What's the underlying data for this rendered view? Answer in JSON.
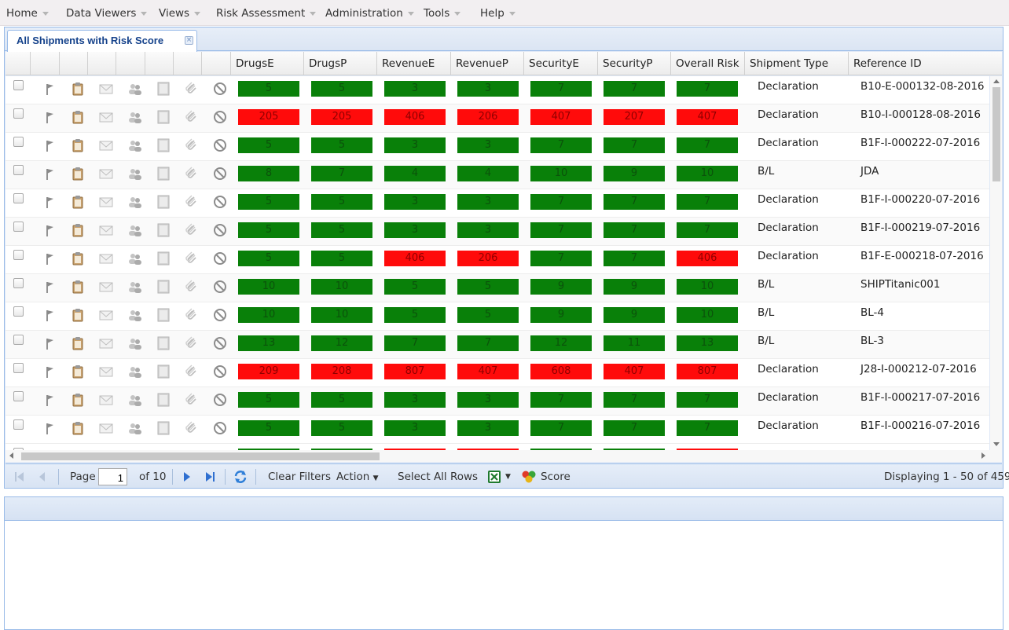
{
  "menu": [
    {
      "label": "Home"
    },
    {
      "label": "Data Viewers"
    },
    {
      "label": "Views"
    },
    {
      "label": "Risk Assessment"
    },
    {
      "label": "Administration"
    },
    {
      "label": "Tools"
    },
    {
      "label": "Help"
    }
  ],
  "tab": {
    "title": "All Shipments with Risk Score"
  },
  "columns": [
    "DrugsE",
    "DrugsP",
    "RevenueE",
    "RevenueP",
    "SecurityE",
    "SecurityP",
    "Overall Risk",
    "Shipment Type",
    "Reference ID"
  ],
  "row_icons": [
    "flag-icon",
    "clipboard-icon",
    "envelope-icon",
    "people-icon",
    "document-icon",
    "paperclip-icon",
    "block-icon"
  ],
  "colors": {
    "green": "#098009",
    "red": "#ff0b0b"
  },
  "rows": [
    {
      "scores": [
        {
          "v": "5",
          "c": "green"
        },
        {
          "v": "5",
          "c": "green"
        },
        {
          "v": "3",
          "c": "green"
        },
        {
          "v": "3",
          "c": "green"
        },
        {
          "v": "7",
          "c": "green"
        },
        {
          "v": "7",
          "c": "green"
        },
        {
          "v": "7",
          "c": "green"
        }
      ],
      "type": "Declaration",
      "ref": "B10-E-000132-08-2016"
    },
    {
      "scores": [
        {
          "v": "205",
          "c": "red"
        },
        {
          "v": "205",
          "c": "red"
        },
        {
          "v": "406",
          "c": "red"
        },
        {
          "v": "206",
          "c": "red"
        },
        {
          "v": "407",
          "c": "red"
        },
        {
          "v": "207",
          "c": "red"
        },
        {
          "v": "407",
          "c": "red"
        }
      ],
      "type": "Declaration",
      "ref": "B10-I-000128-08-2016"
    },
    {
      "scores": [
        {
          "v": "5",
          "c": "green"
        },
        {
          "v": "5",
          "c": "green"
        },
        {
          "v": "3",
          "c": "green"
        },
        {
          "v": "3",
          "c": "green"
        },
        {
          "v": "7",
          "c": "green"
        },
        {
          "v": "7",
          "c": "green"
        },
        {
          "v": "7",
          "c": "green"
        }
      ],
      "type": "Declaration",
      "ref": "B1F-I-000222-07-2016"
    },
    {
      "scores": [
        {
          "v": "8",
          "c": "green"
        },
        {
          "v": "7",
          "c": "green"
        },
        {
          "v": "4",
          "c": "green"
        },
        {
          "v": "4",
          "c": "green"
        },
        {
          "v": "10",
          "c": "green"
        },
        {
          "v": "9",
          "c": "green"
        },
        {
          "v": "10",
          "c": "green"
        }
      ],
      "type": "B/L",
      "ref": "JDA"
    },
    {
      "scores": [
        {
          "v": "5",
          "c": "green"
        },
        {
          "v": "5",
          "c": "green"
        },
        {
          "v": "3",
          "c": "green"
        },
        {
          "v": "3",
          "c": "green"
        },
        {
          "v": "7",
          "c": "green"
        },
        {
          "v": "7",
          "c": "green"
        },
        {
          "v": "7",
          "c": "green"
        }
      ],
      "type": "Declaration",
      "ref": "B1F-I-000220-07-2016"
    },
    {
      "scores": [
        {
          "v": "5",
          "c": "green"
        },
        {
          "v": "5",
          "c": "green"
        },
        {
          "v": "3",
          "c": "green"
        },
        {
          "v": "3",
          "c": "green"
        },
        {
          "v": "7",
          "c": "green"
        },
        {
          "v": "7",
          "c": "green"
        },
        {
          "v": "7",
          "c": "green"
        }
      ],
      "type": "Declaration",
      "ref": "B1F-I-000219-07-2016"
    },
    {
      "scores": [
        {
          "v": "5",
          "c": "green"
        },
        {
          "v": "5",
          "c": "green"
        },
        {
          "v": "406",
          "c": "red"
        },
        {
          "v": "206",
          "c": "red"
        },
        {
          "v": "7",
          "c": "green"
        },
        {
          "v": "7",
          "c": "green"
        },
        {
          "v": "406",
          "c": "red"
        }
      ],
      "type": "Declaration",
      "ref": "B1F-E-000218-07-2016"
    },
    {
      "scores": [
        {
          "v": "10",
          "c": "green"
        },
        {
          "v": "10",
          "c": "green"
        },
        {
          "v": "5",
          "c": "green"
        },
        {
          "v": "5",
          "c": "green"
        },
        {
          "v": "9",
          "c": "green"
        },
        {
          "v": "9",
          "c": "green"
        },
        {
          "v": "10",
          "c": "green"
        }
      ],
      "type": "B/L",
      "ref": "SHIPTitanic001"
    },
    {
      "scores": [
        {
          "v": "10",
          "c": "green"
        },
        {
          "v": "10",
          "c": "green"
        },
        {
          "v": "5",
          "c": "green"
        },
        {
          "v": "5",
          "c": "green"
        },
        {
          "v": "9",
          "c": "green"
        },
        {
          "v": "9",
          "c": "green"
        },
        {
          "v": "10",
          "c": "green"
        }
      ],
      "type": "B/L",
      "ref": "BL-4"
    },
    {
      "scores": [
        {
          "v": "13",
          "c": "green"
        },
        {
          "v": "12",
          "c": "green"
        },
        {
          "v": "7",
          "c": "green"
        },
        {
          "v": "7",
          "c": "green"
        },
        {
          "v": "12",
          "c": "green"
        },
        {
          "v": "11",
          "c": "green"
        },
        {
          "v": "13",
          "c": "green"
        }
      ],
      "type": "B/L",
      "ref": "BL-3"
    },
    {
      "scores": [
        {
          "v": "209",
          "c": "red"
        },
        {
          "v": "208",
          "c": "red"
        },
        {
          "v": "807",
          "c": "red"
        },
        {
          "v": "407",
          "c": "red"
        },
        {
          "v": "608",
          "c": "red"
        },
        {
          "v": "407",
          "c": "red"
        },
        {
          "v": "807",
          "c": "red"
        }
      ],
      "type": "Declaration",
      "ref": "J28-I-000212-07-2016"
    },
    {
      "scores": [
        {
          "v": "5",
          "c": "green"
        },
        {
          "v": "5",
          "c": "green"
        },
        {
          "v": "3",
          "c": "green"
        },
        {
          "v": "3",
          "c": "green"
        },
        {
          "v": "7",
          "c": "green"
        },
        {
          "v": "7",
          "c": "green"
        },
        {
          "v": "7",
          "c": "green"
        }
      ],
      "type": "Declaration",
      "ref": "B1F-I-000217-07-2016"
    },
    {
      "scores": [
        {
          "v": "5",
          "c": "green"
        },
        {
          "v": "5",
          "c": "green"
        },
        {
          "v": "3",
          "c": "green"
        },
        {
          "v": "3",
          "c": "green"
        },
        {
          "v": "7",
          "c": "green"
        },
        {
          "v": "7",
          "c": "green"
        },
        {
          "v": "7",
          "c": "green"
        }
      ],
      "type": "Declaration",
      "ref": "B1F-I-000216-07-2016"
    }
  ],
  "partial_row_colors": [
    "green",
    "green",
    "red",
    "red",
    "green",
    "green",
    "red"
  ],
  "pager": {
    "page_label": "Page",
    "page_value": "1",
    "of_label": "of 10",
    "clear_filters": "Clear Filters",
    "action": "Action",
    "select_all": "Select All Rows",
    "score": "Score",
    "displaying": "Displaying 1 - 50 of 459"
  }
}
